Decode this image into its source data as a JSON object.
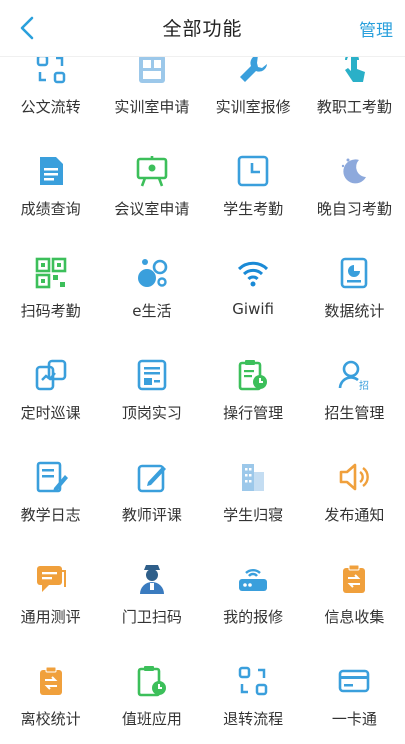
{
  "header": {
    "title": "全部功能",
    "manage_label": "管理"
  },
  "colors": {
    "accent": "#2aa0dc",
    "green": "#3cbf5a",
    "orange": "#f0a03c",
    "blue": "#3a9fdc"
  },
  "grid": {
    "rows": [
      [
        {
          "label": "公文流转",
          "icon": "flow-icon"
        },
        {
          "label": "实训室申请",
          "icon": "layout-icon"
        },
        {
          "label": "实训室报修",
          "icon": "wrench-icon"
        },
        {
          "label": "教职工考勤",
          "icon": "touch-icon"
        }
      ],
      [
        {
          "label": "成绩查询",
          "icon": "document-icon"
        },
        {
          "label": "会议室申请",
          "icon": "easel-icon"
        },
        {
          "label": "学生考勤",
          "icon": "clock-icon"
        },
        {
          "label": "晚自习考勤",
          "icon": "moon-icon"
        }
      ],
      [
        {
          "label": "扫码考勤",
          "icon": "qrcode-icon"
        },
        {
          "label": "e生活",
          "icon": "bubbles-icon"
        },
        {
          "label": "Giwifi",
          "icon": "wifi-icon"
        },
        {
          "label": "数据统计",
          "icon": "chart-icon"
        }
      ],
      [
        {
          "label": "定时巡课",
          "icon": "patrol-icon"
        },
        {
          "label": "顶岗实习",
          "icon": "badge-icon"
        },
        {
          "label": "操行管理",
          "icon": "clipboard-clock-icon"
        },
        {
          "label": "招生管理",
          "icon": "enroll-icon"
        }
      ],
      [
        {
          "label": "教学日志",
          "icon": "journal-icon"
        },
        {
          "label": "教师评课",
          "icon": "edit-icon"
        },
        {
          "label": "学生归寝",
          "icon": "building-icon"
        },
        {
          "label": "发布通知",
          "icon": "speaker-icon"
        }
      ],
      [
        {
          "label": "通用测评",
          "icon": "message-icon"
        },
        {
          "label": "门卫扫码",
          "icon": "guard-icon"
        },
        {
          "label": "我的报修",
          "icon": "router-icon"
        },
        {
          "label": "信息收集",
          "icon": "collect-icon"
        }
      ],
      [
        {
          "label": "离校统计",
          "icon": "leave-icon"
        },
        {
          "label": "值班应用",
          "icon": "duty-icon"
        },
        {
          "label": "退转流程",
          "icon": "transfer-icon"
        },
        {
          "label": "一卡通",
          "icon": "card-icon"
        }
      ]
    ]
  }
}
